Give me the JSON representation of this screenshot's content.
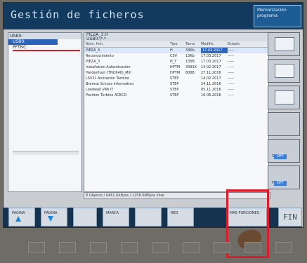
{
  "window": {
    "title": "Gestión de ficheros",
    "mode_label": "Memorización programa"
  },
  "left_panel": {
    "header": "USB0:",
    "items": [
      "USB0:",
      "PFTNC:"
    ]
  },
  "file_panel": {
    "path": "PIEZA_3.H",
    "subpath": "USB0:\\*.*",
    "columns": [
      "Nom. fich.",
      "Tipo",
      "Tama",
      "Modific.",
      "Estado"
    ],
    "rows": [
      [
        "PIEZA_3",
        "H",
        "33Kb",
        "17.03.2017",
        "-----"
      ],
      [
        "Reconocimiento",
        "CSV",
        "13Kb",
        "17.03.2017",
        "-----"
      ],
      [
        "PIEZA_3",
        "H_T",
        "135B",
        "17.03.2017",
        "-----"
      ],
      [
        "Installation Autenticación",
        "HPTM",
        "3391K",
        "14.02.2017",
        "-----"
      ],
      [
        "Heidenhain (TNC640)_Mill",
        "HPTM",
        "806B",
        "27.11.2016",
        "-----"
      ],
      [
        "LSV2L Anotación Turbine",
        "STEP",
        "",
        "14.02.2017",
        "-----"
      ],
      [
        "Bremse Schuss Information",
        "STEP",
        "",
        "24.11.2016",
        "-----"
      ],
      [
        "Loadwall V46 IT",
        "STEP",
        "",
        "05.11.2016",
        "-----"
      ],
      [
        "Position Turbine ACECO",
        "STEP",
        "",
        "16.06.2016",
        "-----"
      ]
    ],
    "status": "8 Objetos / 6461.6KByte / 1258.0MByte libre"
  },
  "sidebar": {
    "buttons": [
      {
        "label": "",
        "icon": "file-icon"
      },
      {
        "label": "",
        "icon": "folder-icon"
      },
      {
        "label": "",
        "icon": "compare-icon"
      },
      {
        "label": "",
        "icon": "empty"
      },
      {
        "label": "Sim",
        "badge": "OFF"
      },
      {
        "label": "F",
        "badge": "OFF"
      }
    ]
  },
  "softkeys": [
    {
      "label": "PAGINA",
      "icon": "up-arrow-icon"
    },
    {
      "label": "PAGINA",
      "icon": "down-arrow-icon"
    },
    {
      "label": "",
      "icon": ""
    },
    {
      "label": "MARCA",
      "icon": "checkbox-icon"
    },
    {
      "label": "",
      "icon": ""
    },
    {
      "label": "RED",
      "icon": ""
    },
    {
      "label": "MAS FUNCIONES",
      "icon": ""
    },
    {
      "label": "FIN",
      "icon": ""
    }
  ]
}
